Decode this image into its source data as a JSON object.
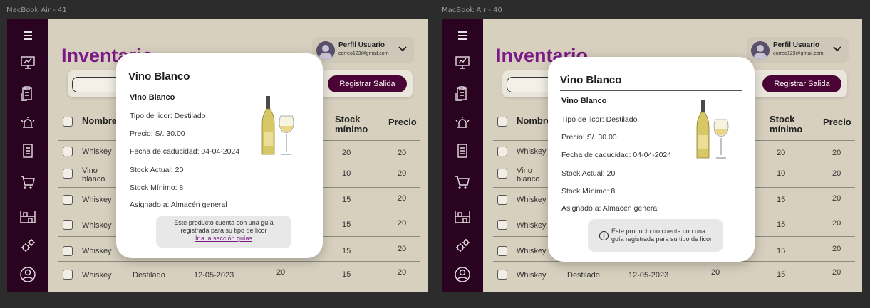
{
  "frames": [
    {
      "label": "MacBook Air - 41",
      "page_title": "Inventario",
      "profile": {
        "name": "Perfil Usuario",
        "email": "correo123@gmail.com"
      },
      "exit_button": "Registrar Salida",
      "table": {
        "headers": [
          "Nombre",
          "Stock mínimo",
          "Precio"
        ],
        "rows": [
          {
            "name": "Whiskey",
            "min": "20",
            "price": "20"
          },
          {
            "name": "Vino blanco",
            "min": "10",
            "price": "20"
          },
          {
            "name": "Whiskey",
            "min": "15",
            "price": "20"
          },
          {
            "name": "Whiskey",
            "min": "15",
            "price": "20"
          },
          {
            "name": "Whiskey",
            "min": "15",
            "price": "20"
          },
          {
            "name": "Whiskey",
            "type": "Destilado",
            "date": "12-05-2023",
            "stock": "20",
            "min": "15",
            "price": "20"
          }
        ]
      },
      "modal": {
        "title": "Vino Blanco",
        "product_name": "Vino Blanco",
        "fields": [
          "Tipo de licor: Destilado",
          "Precio: S/. 30.00",
          "Fecha de caducidad: 04-04-2024",
          "Stock Actual: 20",
          "Stock Mínimo: 8",
          "Asignado a: Almacén general"
        ],
        "note_line1": "Este producto cuenta con una guía",
        "note_line2": "registrada para su tipo de licor",
        "note_link": "Ir a la sección guías"
      }
    },
    {
      "label": "MacBook Air - 40",
      "page_title": "Inventario",
      "profile": {
        "name": "Perfil Usuario",
        "email": "correo123@gmail.com"
      },
      "exit_button": "Registrar Salida",
      "table": {
        "headers": [
          "Nombre",
          "Stock mínimo",
          "Precio"
        ],
        "rows": [
          {
            "name": "Whiskey",
            "min": "20",
            "price": "20"
          },
          {
            "name": "Vino blanco",
            "min": "10",
            "price": "20"
          },
          {
            "name": "Whiskey",
            "min": "15",
            "price": "20"
          },
          {
            "name": "Whiskey",
            "min": "15",
            "price": "20"
          },
          {
            "name": "Whiskey",
            "min": "15",
            "price": "20"
          },
          {
            "name": "Whiskey",
            "type": "Destilado",
            "date": "12-05-2023",
            "stock": "20",
            "min": "15",
            "price": "20"
          }
        ]
      },
      "modal": {
        "title": "Vino Blanco",
        "product_name": "Vino Blanco",
        "fields": [
          "Tipo de licor: Destilado",
          "Precio: S/. 30.00",
          "Fecha de caducidad: 04-04-2024",
          "Stock Actual: 20",
          "Stock Mínimo: 8",
          "Asignado a: Almacén general"
        ],
        "note_line1": "Este producto no cuenta con una",
        "note_line2": "guía registrada para su tipo de licor",
        "info_icon": "info-icon"
      }
    }
  ],
  "sidebar_icons": [
    "menu-icon",
    "dashboard-icon",
    "clipboard-icon",
    "alarm-icon",
    "document-icon",
    "cart-icon",
    "warehouse-icon",
    "settings-icon",
    "user-icon"
  ],
  "colors": {
    "sidebar": "#2a0320",
    "accent": "#7b1a86",
    "button": "#4a0436",
    "background": "#d8d0bf"
  }
}
